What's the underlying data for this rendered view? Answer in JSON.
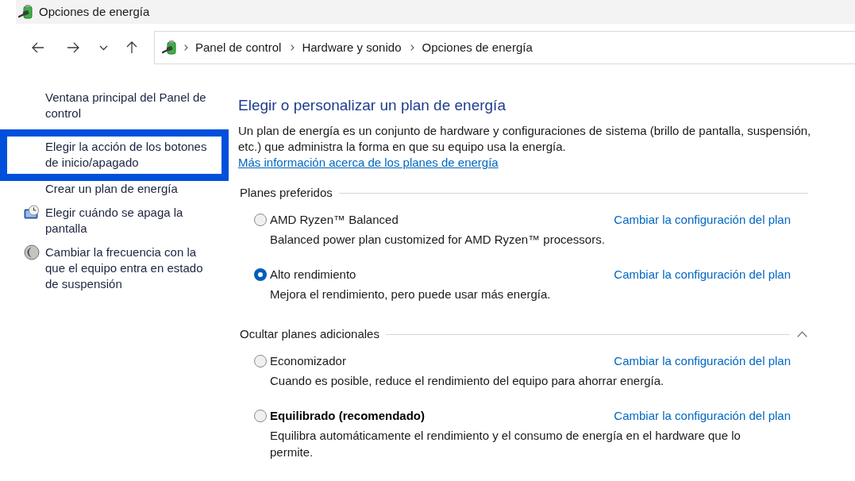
{
  "window": {
    "title": "Opciones de energía"
  },
  "address_bar": {
    "path": [
      "Panel de control",
      "Hardware y sonido",
      "Opciones de energía"
    ]
  },
  "sidebar": {
    "items": [
      {
        "label": "Ventana principal del Panel de control",
        "kind": "plain",
        "highlighted": false
      },
      {
        "label": "Elegir la acción de los botones de inicio/apagado",
        "kind": "plain",
        "highlighted": true
      },
      {
        "label": "Crear un plan de energía",
        "kind": "plain",
        "highlighted": false
      },
      {
        "label": "Elegir cuándo se apaga la pantalla",
        "kind": "display",
        "highlighted": false
      },
      {
        "label": "Cambiar la frecuencia con la que el equipo entra en estado de suspensión",
        "kind": "sleep",
        "highlighted": false
      }
    ]
  },
  "main": {
    "heading": "Elegir o personalizar un plan de energía",
    "description": "Un plan de energía es un conjunto de hardware y configuraciones de sistema (brillo de pantalla, suspensión, etc.) que administra la forma en que su equipo usa la energía.",
    "more_info_link": "Más información acerca de los planes de energía",
    "groups": [
      {
        "title": "Planes preferidos",
        "kind": "fixed",
        "plans": [
          {
            "name": "AMD Ryzen™ Balanced",
            "description": "Balanced power plan customized for AMD Ryzen™ processors.",
            "change_link": "Cambiar la configuración del plan",
            "selected": false,
            "emphasized": false
          },
          {
            "name": "Alto rendimiento",
            "description": "Mejora el rendimiento, pero puede usar más energía.",
            "change_link": "Cambiar la configuración del plan",
            "selected": true,
            "emphasized": false
          }
        ]
      },
      {
        "title": "Ocultar planes adicionales",
        "kind": "collapsible",
        "expanded": true,
        "plans": [
          {
            "name": "Economizador",
            "description": "Cuando es posible, reduce el rendimiento del equipo para ahorrar energía.",
            "change_link": "Cambiar la configuración del plan",
            "selected": false,
            "emphasized": false
          },
          {
            "name": "Equilibrado (recomendado)",
            "description": "Equilibra automáticamente el rendimiento y el consumo de energía en el hardware que lo permite.",
            "change_link": "Cambiar la configuración del plan",
            "selected": false,
            "emphasized": true
          }
        ]
      }
    ]
  }
}
